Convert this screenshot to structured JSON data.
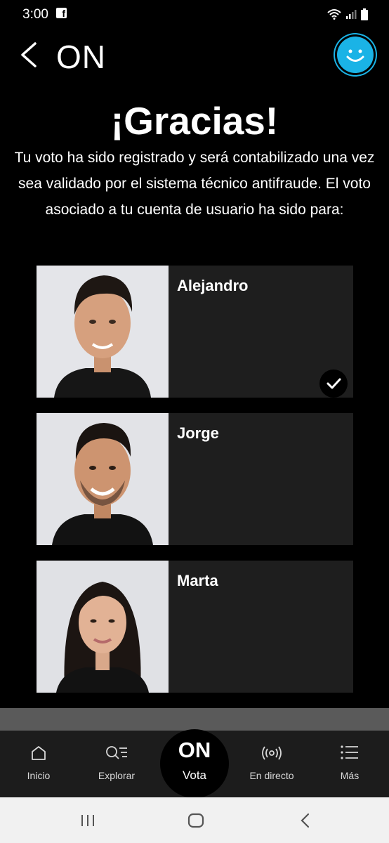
{
  "status_bar": {
    "time": "3:00",
    "fb_glyph": "f"
  },
  "header": {
    "title": "ON"
  },
  "confirmation": {
    "title": "¡Gracias!",
    "message": "Tu voto ha sido registrado y será contabilizado una vez sea validado por el sistema técnico antifraude. El voto asociado a tu cuenta de usuario ha sido para:"
  },
  "candidates": [
    {
      "name": "Alejandro",
      "selected": true
    },
    {
      "name": "Jorge",
      "selected": false
    },
    {
      "name": "Marta",
      "selected": false
    }
  ],
  "bottom_nav": {
    "items": [
      {
        "label": "Inicio",
        "icon": "home-icon"
      },
      {
        "label": "Explorar",
        "icon": "explore-icon"
      },
      {
        "label": "Vota",
        "logo": "ON"
      },
      {
        "label": "En directo",
        "icon": "live-icon"
      },
      {
        "label": "Más",
        "icon": "menu-icon"
      }
    ]
  },
  "colors": {
    "accent": "#1ab3e6",
    "card_bg": "#1e1e1e",
    "nav_bg": "#1c1c1c"
  }
}
